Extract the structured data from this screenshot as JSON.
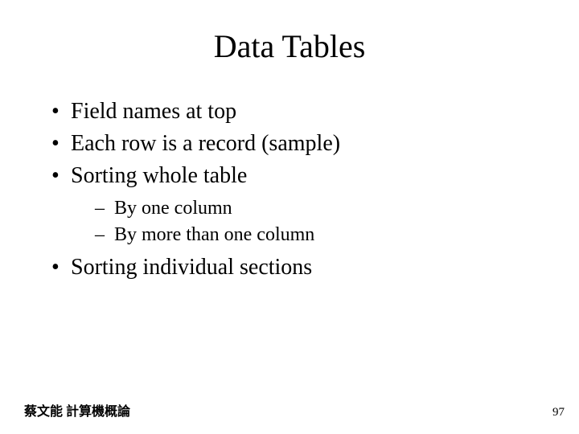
{
  "title": "Data Tables",
  "bullets": {
    "b1": "Field names at top",
    "b2": "Each row is a record (sample)",
    "b3": "Sorting whole table",
    "b3_sub1": "By one column",
    "b3_sub2": "By more than one column",
    "b4": "Sorting individual sections"
  },
  "footer": {
    "left": "蔡文能 計算機概論",
    "page": "97"
  }
}
